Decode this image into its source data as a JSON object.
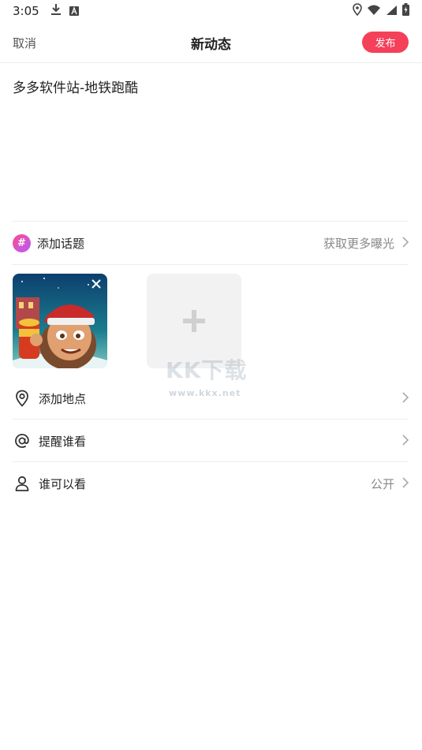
{
  "status_bar": {
    "time": "3:05",
    "left_icons": [
      "download-icon",
      "keyboard-a-icon"
    ],
    "right_icons": [
      "location-icon",
      "wifi-icon",
      "signal-icon",
      "battery-charging-icon"
    ]
  },
  "nav": {
    "cancel_label": "取消",
    "title": "新动态",
    "publish_label": "发布",
    "accent_color": "#f5405a"
  },
  "post": {
    "text": "多多软件站-地铁跑酷"
  },
  "topic": {
    "icon": "hashtag-icon",
    "label": "添加话题",
    "hint": "获取更多曝光"
  },
  "media": {
    "thumbnail": "subway-surfers-image",
    "add_icon": "plus-icon"
  },
  "watermark": {
    "main": "KK下载",
    "url": "www.kkx.net"
  },
  "rows": [
    {
      "icon": "location-pin-icon",
      "label": "添加地点",
      "value": ""
    },
    {
      "icon": "at-icon",
      "label": "提醒谁看",
      "value": ""
    },
    {
      "icon": "user-icon",
      "label": "谁可以看",
      "value": "公开"
    }
  ]
}
